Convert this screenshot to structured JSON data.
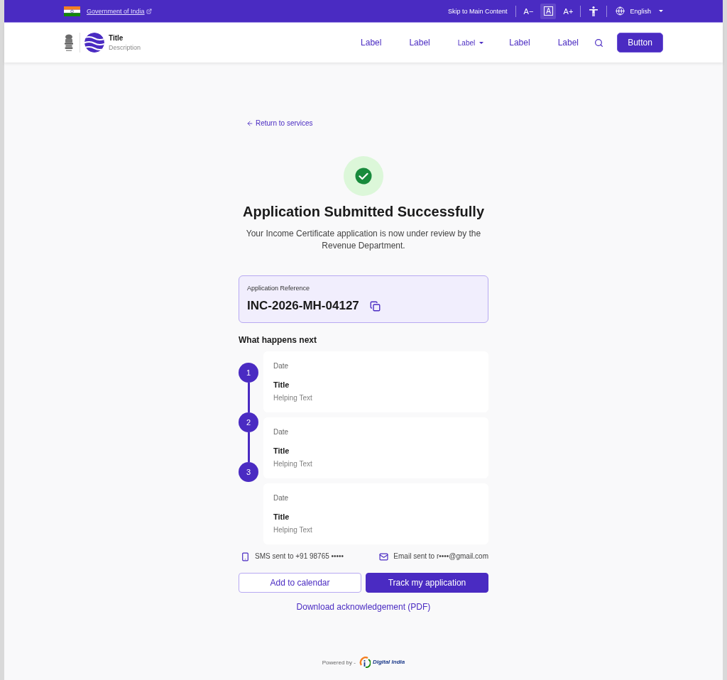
{
  "top_bar": {
    "gov_link": "Government of India",
    "skip_link": "Skip to Main Content",
    "text_size_controls": [
      {
        "label": "A−",
        "kind": "decrease",
        "selected": false
      },
      {
        "label": "A",
        "kind": "default",
        "selected": true
      },
      {
        "label": "A+",
        "kind": "increase",
        "selected": false
      }
    ],
    "language": "English"
  },
  "header": {
    "title": "Title",
    "description": "Description",
    "nav": [
      {
        "label": "Label",
        "kind": "link"
      },
      {
        "label": "Label",
        "kind": "link"
      },
      {
        "label": "Label",
        "kind": "dropdown"
      },
      {
        "label": "Label",
        "kind": "link"
      },
      {
        "label": "Label",
        "kind": "link"
      }
    ],
    "button": "Button"
  },
  "back_link": "Return to services",
  "hero": {
    "heading": "Application Submitted Successfully",
    "message": "Your Income Certificate application is now under review by the Revenue Department."
  },
  "reference": {
    "label": "Application Reference",
    "value": "INC-2026-MH-04127"
  },
  "next_steps": {
    "heading": "What happens next",
    "steps": [
      {
        "number": "1",
        "date": "Date",
        "title": "Title",
        "helper": "Helping Text"
      },
      {
        "number": "2",
        "date": "Date",
        "title": "Title",
        "helper": "Helping Text"
      },
      {
        "number": "3",
        "date": "Date",
        "title": "Title",
        "helper": "Helping Text"
      }
    ]
  },
  "notifications": [
    {
      "kind": "sms",
      "text": "SMS sent to +91 98765 •••••"
    },
    {
      "kind": "email",
      "text": "Email sent to r••••@gmail.com"
    }
  ],
  "actions": [
    {
      "label": "Add to calendar",
      "kind": "secondary"
    },
    {
      "label": "Track my application",
      "kind": "primary"
    }
  ],
  "download_link": "Download acknowledgement (PDF)",
  "footer": {
    "powered_by": "Powered by -",
    "logo_text": "Digital India"
  }
}
